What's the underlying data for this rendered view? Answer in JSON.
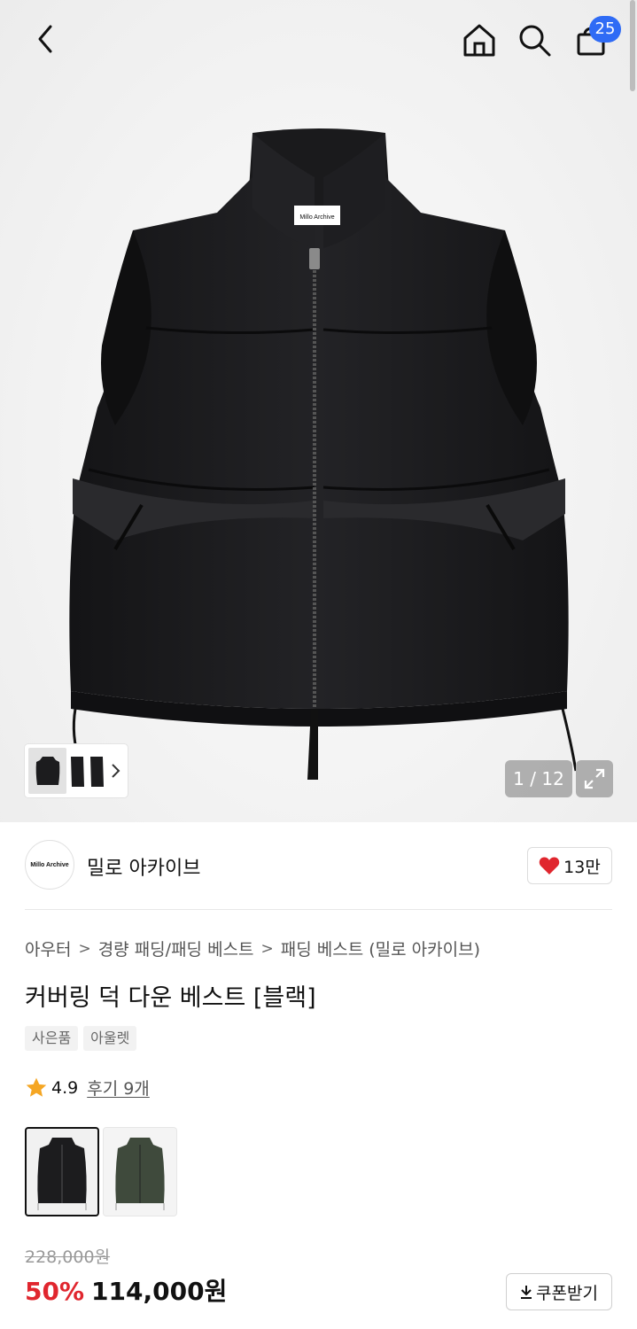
{
  "header": {
    "cart_count": "25",
    "icons": [
      "back-icon",
      "home-icon",
      "search-icon",
      "shopping-bag-icon"
    ]
  },
  "gallery": {
    "counter": "1 / 12",
    "label_text": "Millo Archive"
  },
  "brand": {
    "logo_text": "Millo Archive",
    "name": "밀로 아카이브",
    "likes": "13만"
  },
  "breadcrumb": [
    "아우터",
    "경량 패딩/패딩 베스트",
    "패딩 베스트 (밀로 아카이브)"
  ],
  "product": {
    "title": "커버링 덕 다운 베스트 [블랙]",
    "tags": [
      "사은품",
      "아울렛"
    ],
    "rating": "4.9",
    "reviews": "후기 9개",
    "original_price": "228,000원",
    "discount": "50%",
    "price": "114,000원",
    "coupon_label": "쿠폰받기"
  },
  "colors": {
    "accent": "#e0262e",
    "badge": "#2f6bf5",
    "star": "#f5a623",
    "vest_black": "#1c1c1e",
    "vest_green": "#3f4a3c"
  }
}
